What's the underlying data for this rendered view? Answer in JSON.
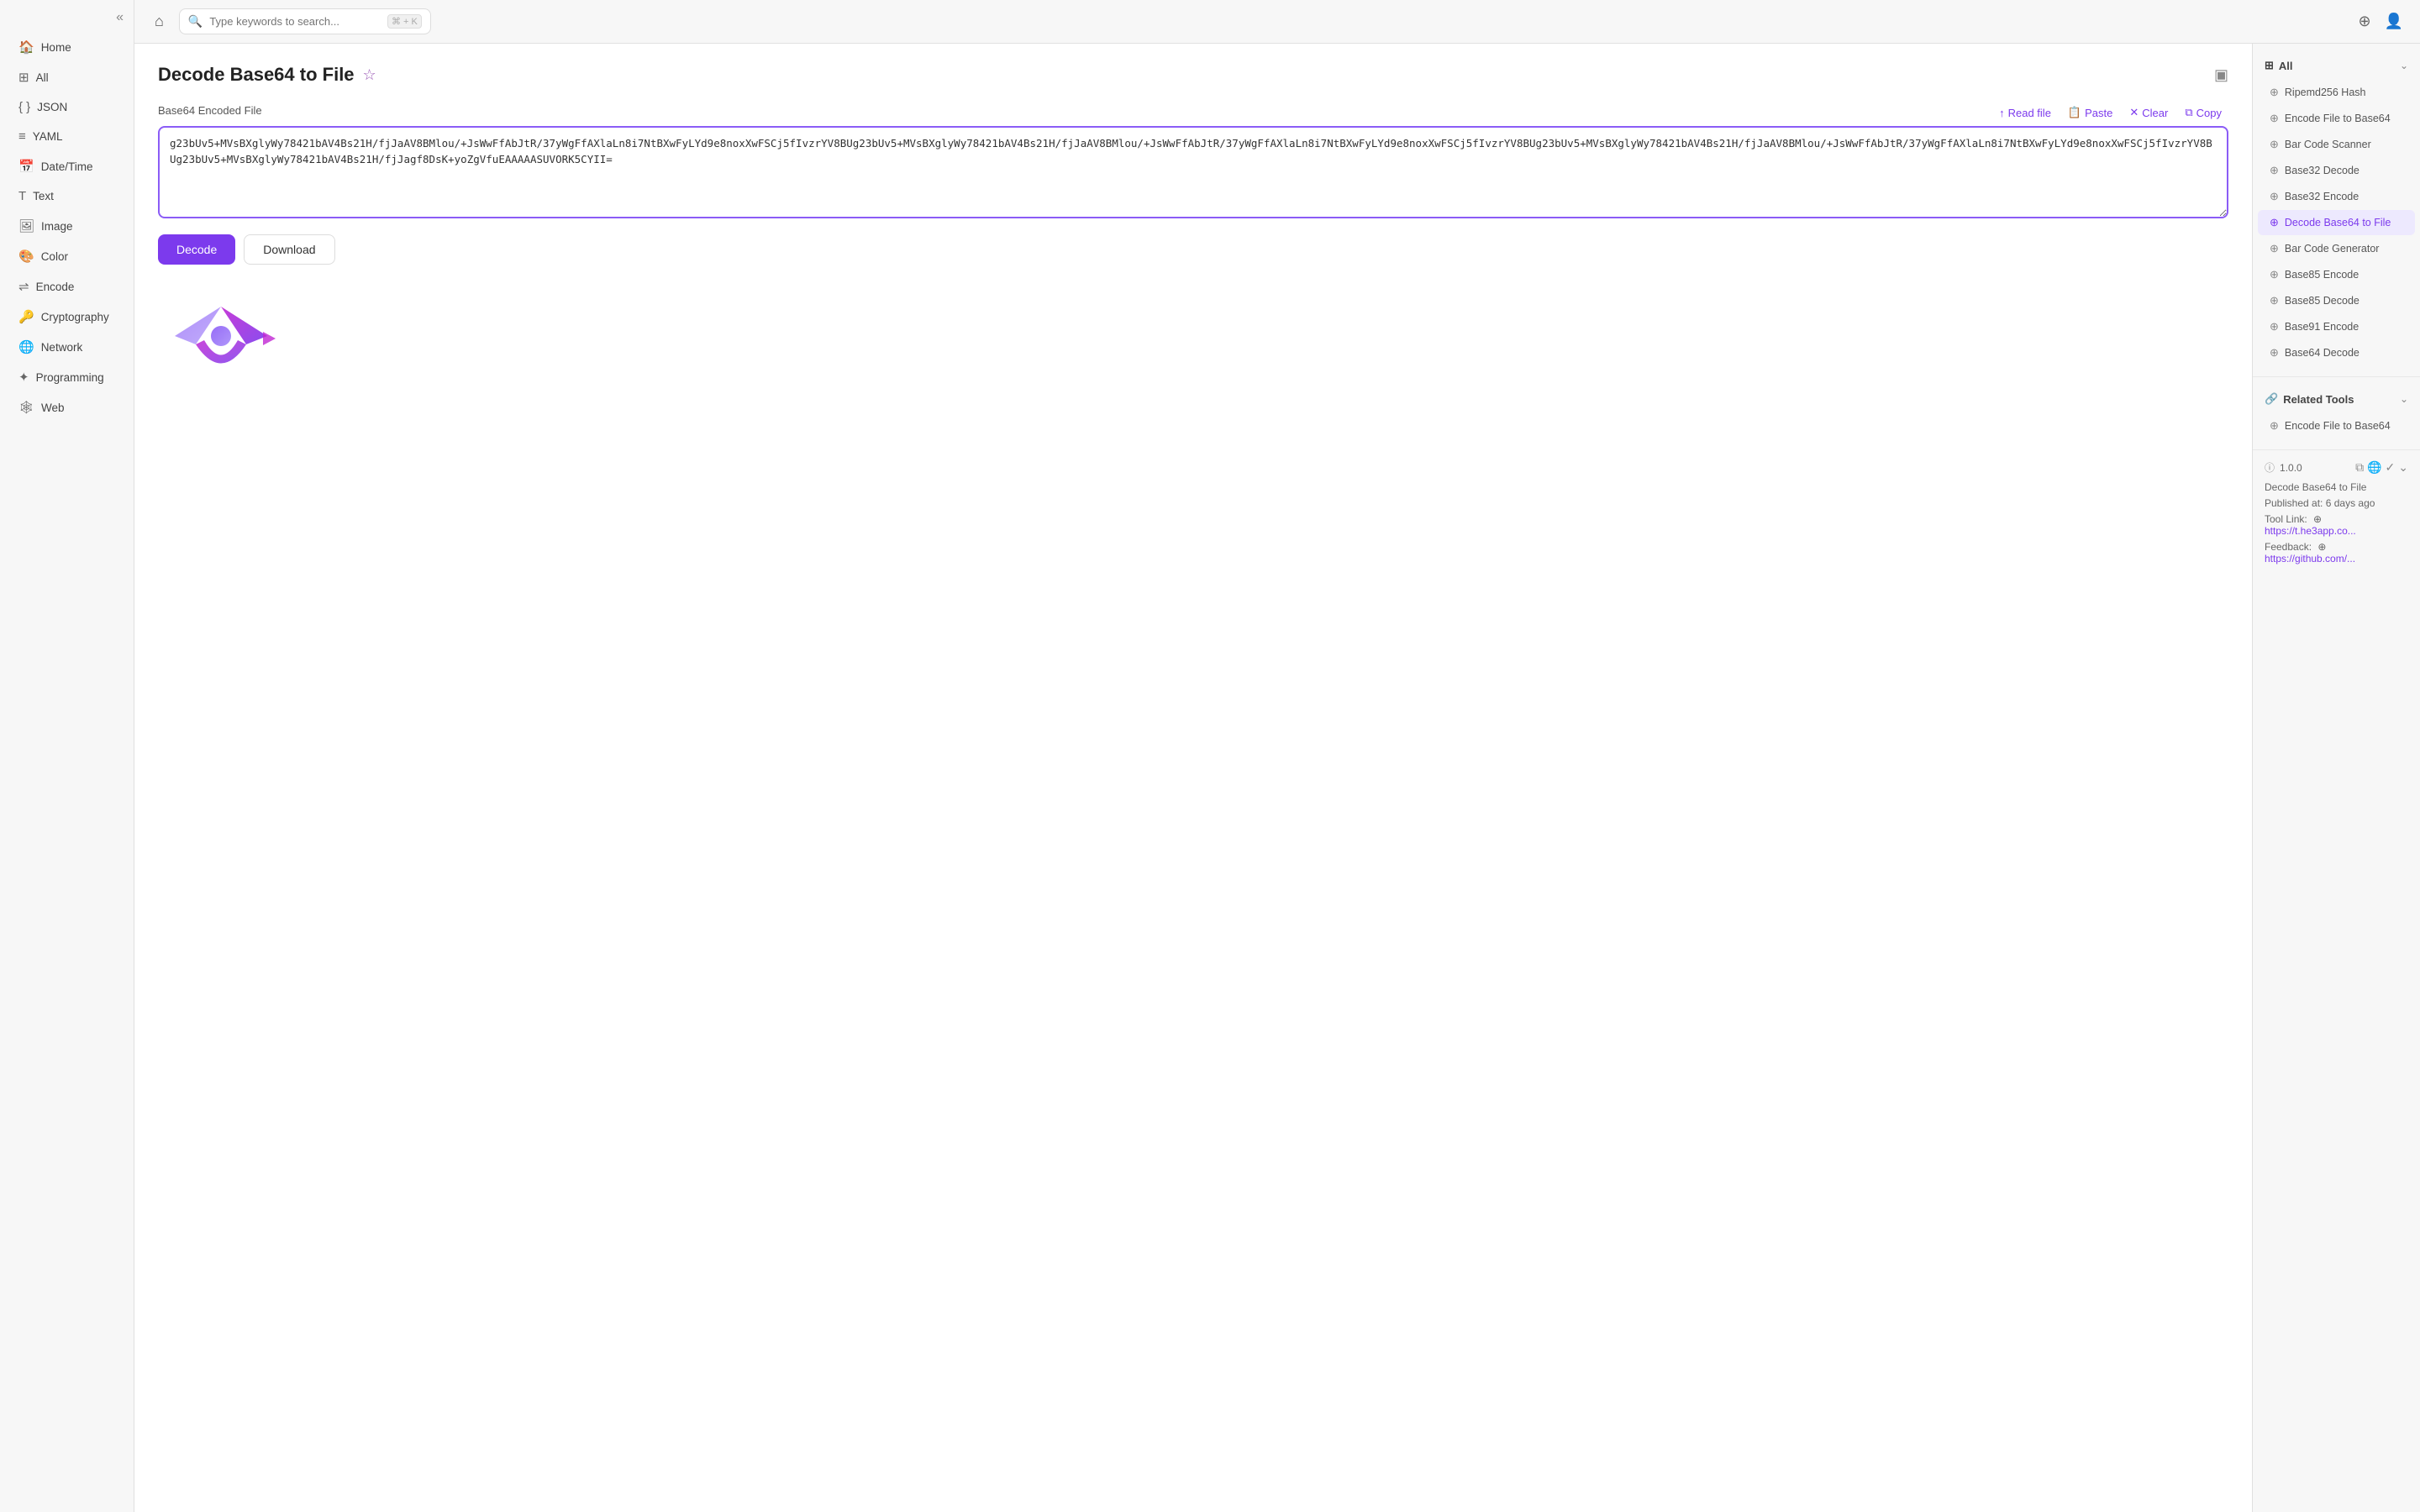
{
  "sidebar": {
    "collapse_icon": "«",
    "items": [
      {
        "id": "home",
        "label": "Home",
        "icon": "🏠",
        "active": false
      },
      {
        "id": "all",
        "label": "All",
        "icon": "⊞",
        "active": false
      },
      {
        "id": "json",
        "label": "JSON",
        "icon": "{ }",
        "active": false
      },
      {
        "id": "yaml",
        "label": "YAML",
        "icon": "≡",
        "active": false
      },
      {
        "id": "datetime",
        "label": "Date/Time",
        "icon": "📅",
        "active": false
      },
      {
        "id": "text",
        "label": "Text",
        "icon": "T",
        "active": false
      },
      {
        "id": "image",
        "label": "Image",
        "icon": "🖼",
        "active": false
      },
      {
        "id": "color",
        "label": "Color",
        "icon": "🎨",
        "active": false
      },
      {
        "id": "encode",
        "label": "Encode",
        "icon": "⇌",
        "active": false
      },
      {
        "id": "cryptography",
        "label": "Cryptography",
        "icon": "🔑",
        "active": false
      },
      {
        "id": "network",
        "label": "Network",
        "icon": "🌐",
        "active": false
      },
      {
        "id": "programming",
        "label": "Programming",
        "icon": "✦",
        "active": false
      },
      {
        "id": "web",
        "label": "Web",
        "icon": "🕸",
        "active": false
      }
    ]
  },
  "topbar": {
    "home_icon": "⌂",
    "search_placeholder": "Type keywords to search...",
    "shortcut": "⌘ + K",
    "share_icon": "⊕",
    "user_icon": "👤"
  },
  "page": {
    "title": "Decode Base64 to File",
    "star_icon": "☆",
    "layout_icon": "▣"
  },
  "input_section": {
    "label": "Base64 Encoded File",
    "read_file_btn": "Read file",
    "paste_btn": "Paste",
    "clear_btn": "Clear",
    "copy_btn": "Copy",
    "textarea_value": "g23bUv5+MVsBXglyWy78421bAV4Bs21H/fjJaAV8BMlou/+JsWwFfAbJtR/37yWgFfAXlaLn8i7NtBXwFyLYd9e8noxXwFSCj5fIvzrYV8BUg23bUv5+MVsBXglyWy78421bAV4Bs21H/fjJaAV8BMlou/+JsWwFfAbJtR/37yWgFfAXlaLn8i7NtBXwFyLYd9e8noxXwFSCj5fIvzrYV8BUg23bUv5+MVsBXglyWy78421bAV4Bs21H/fjJaAV8BMlou/+JsWwFfAbJtR/37yWgFfAXlaLn8i7NtBXwFyLYd9e8noxXwFSCj5fIvzrYV8BUg23bUv5+MVsBXglyWy78421bAV4Bs21H/fjJagf8DsK+yoZgVfuEAAAAASUVORK5CYII="
  },
  "buttons": {
    "decode": "Decode",
    "download": "Download"
  },
  "right_panel": {
    "all_section": {
      "title": "All",
      "items": [
        {
          "id": "ripemd256",
          "label": "Ripemd256 Hash",
          "active": false
        },
        {
          "id": "encode-file-base64",
          "label": "Encode File to Base64",
          "active": false
        },
        {
          "id": "barcode-scanner",
          "label": "Bar Code Scanner",
          "active": false
        },
        {
          "id": "base32-decode",
          "label": "Base32 Decode",
          "active": false
        },
        {
          "id": "base32-encode",
          "label": "Base32 Encode",
          "active": false
        },
        {
          "id": "decode-base64-file",
          "label": "Decode Base64 to File",
          "active": true
        },
        {
          "id": "barcode-generator",
          "label": "Bar Code Generator",
          "active": false
        },
        {
          "id": "base85-encode",
          "label": "Base85 Encode",
          "active": false
        },
        {
          "id": "base85-decode",
          "label": "Base85 Decode",
          "active": false
        },
        {
          "id": "base91-encode",
          "label": "Base91 Encode",
          "active": false
        },
        {
          "id": "base64-decode",
          "label": "Base64 Decode",
          "active": false
        }
      ]
    },
    "related_section": {
      "title": "Related Tools",
      "items": [
        {
          "id": "encode-file-base64-2",
          "label": "Encode File to Base64",
          "active": false
        }
      ]
    },
    "version_section": {
      "version": "1.0.0",
      "tool_name": "Decode Base64 to File",
      "published": "Published at: 6 days ago",
      "tool_link_label": "Tool Link:",
      "tool_link_url": "https://t.he3app.co...",
      "feedback_label": "Feedback:",
      "feedback_url": "https://github.com/..."
    }
  }
}
